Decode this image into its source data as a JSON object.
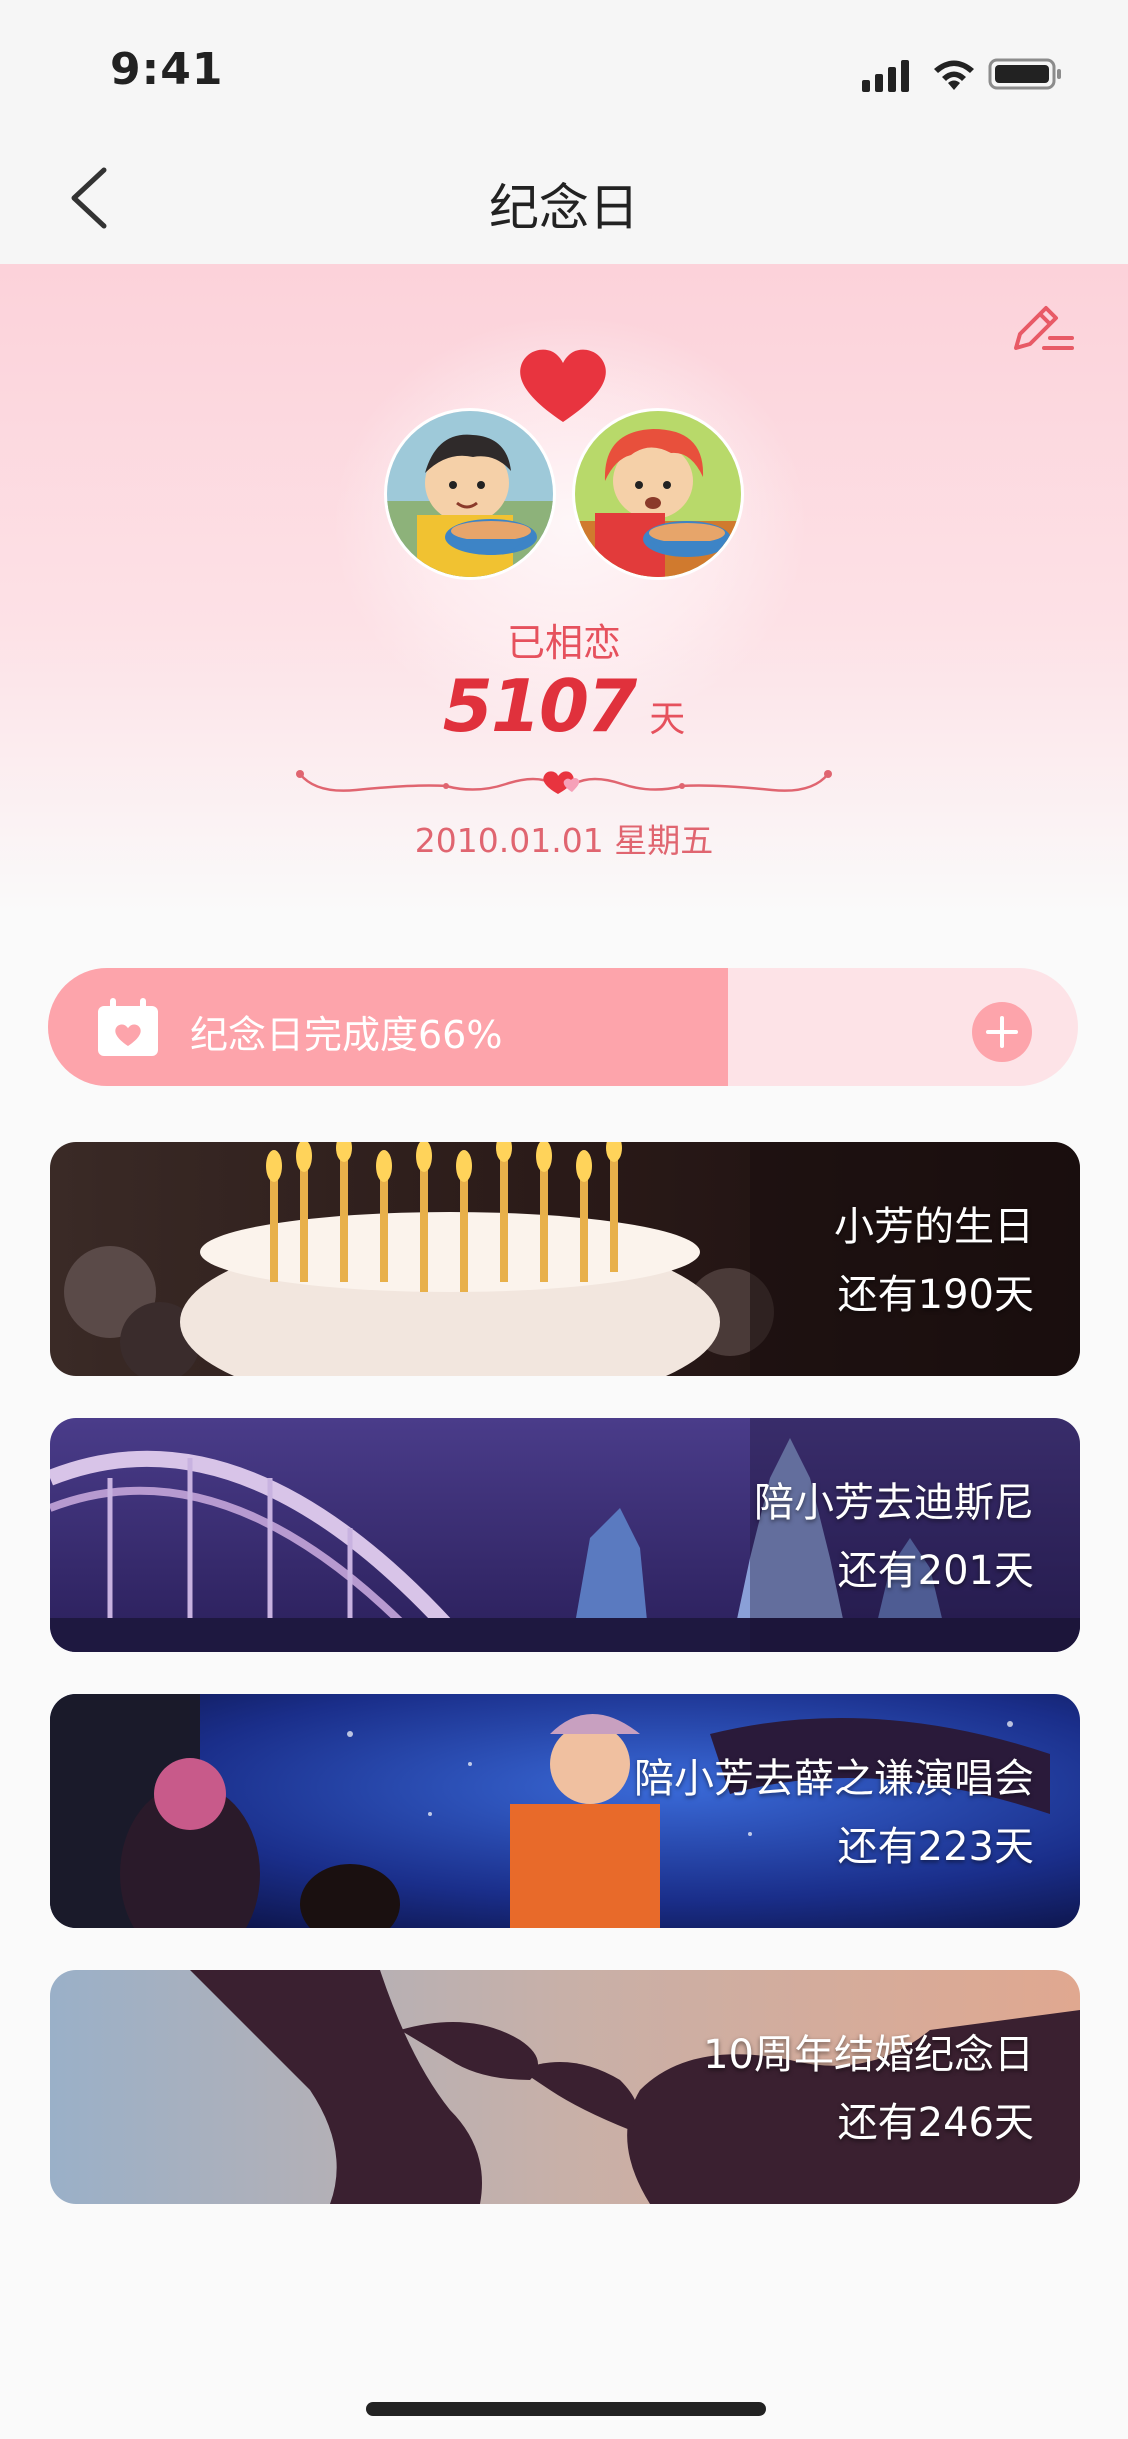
{
  "status_bar": {
    "time": "9:41"
  },
  "nav": {
    "title": "纪念日",
    "back_icon": "chevron-left-icon"
  },
  "hero": {
    "edit_icon": "edit-pen-icon",
    "caption": "已相恋",
    "days": "5107",
    "days_unit": "天",
    "start_date": "2010.01.01 星期五"
  },
  "progress": {
    "label": "纪念日完成度66%",
    "value": 0.66,
    "icon": "calendar-heart-icon",
    "add_icon": "plus-icon"
  },
  "events": [
    {
      "title": "小芳的生日",
      "countdown": "还有190天"
    },
    {
      "title": "陪小芳去迪斯尼",
      "countdown": "还有201天"
    },
    {
      "title": "陪小芳去薛之谦演唱会",
      "countdown": "还有223天"
    },
    {
      "title": "10周年结婚纪念日",
      "countdown": "还有246天"
    }
  ],
  "colors": {
    "accent": "#e0313c",
    "progress_fill": "#fda4ab",
    "progress_track": "#fde3e7"
  }
}
